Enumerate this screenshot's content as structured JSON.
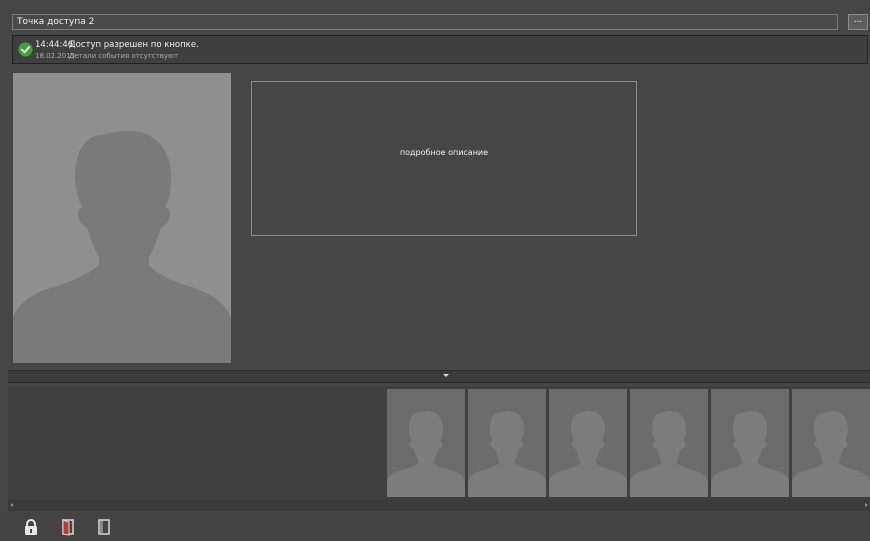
{
  "header": {
    "access_point_name": "Точка доступа 2",
    "more_button_label": "..."
  },
  "event": {
    "time": "14:44:46",
    "date": "18.02.2015",
    "message": "Доступ разрешен по кнопке.",
    "details": "Детали события отсутствуют",
    "status_icon": "check-circle-icon",
    "status_color": "#3aa63a"
  },
  "description": {
    "placeholder": "подробное описание"
  },
  "toolbar": {
    "icons": [
      "lock-icon",
      "door-open-icon",
      "door-closed-icon"
    ]
  },
  "colors": {
    "background": "#464646",
    "photo_bg": "#8f8f8f",
    "thumb_bg": "#6c6c6c"
  }
}
